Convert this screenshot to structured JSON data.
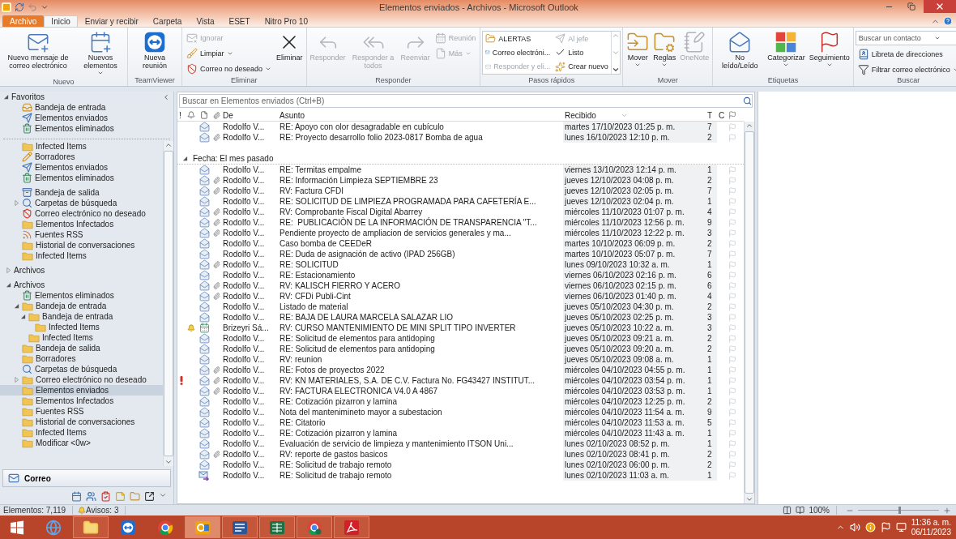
{
  "window": {
    "title": "Elementos enviados - Archivos - Microsoft Outlook"
  },
  "tabs": [
    {
      "label": "Archivo",
      "kind": "backstage",
      "selected": false
    },
    {
      "label": "Inicio",
      "kind": "tab",
      "selected": true
    },
    {
      "label": "Enviar y recibir",
      "kind": "tab",
      "selected": false
    },
    {
      "label": "Carpeta",
      "kind": "tab",
      "selected": false
    },
    {
      "label": "Vista",
      "kind": "tab",
      "selected": false
    },
    {
      "label": "ESET",
      "kind": "tab",
      "selected": false
    },
    {
      "label": "Nitro Pro 10",
      "kind": "tab",
      "selected": false
    }
  ],
  "ribbon": {
    "groups": [
      {
        "label": "Nuevo",
        "items": [
          {
            "kind": "large",
            "label": "Nuevo mensaje de correo electrónico",
            "disabled": false,
            "dropdown": false
          },
          {
            "kind": "large",
            "label": "Nuevos elementos",
            "disabled": false,
            "dropdown": true
          }
        ]
      },
      {
        "label": "TeamViewer",
        "items": [
          {
            "kind": "large",
            "label": "Nueva reunión",
            "disabled": false,
            "dropdown": false
          }
        ]
      },
      {
        "label": "Eliminar",
        "items": [
          {
            "kind": "small",
            "label": "Ignorar",
            "disabled": true,
            "dropdown": false
          },
          {
            "kind": "small",
            "label": "Limpiar",
            "disabled": false,
            "dropdown": true
          },
          {
            "kind": "small",
            "label": "Correo no deseado",
            "disabled": false,
            "dropdown": true
          },
          {
            "kind": "large",
            "label": "Eliminar",
            "disabled": false,
            "dropdown": false
          }
        ]
      },
      {
        "label": "Responder",
        "items": [
          {
            "kind": "large",
            "label": "Responder",
            "disabled": true,
            "dropdown": false
          },
          {
            "kind": "large",
            "label": "Responder a todos",
            "disabled": true,
            "dropdown": false
          },
          {
            "kind": "large",
            "label": "Reenviar",
            "disabled": true,
            "dropdown": false
          },
          {
            "kind": "small",
            "label": "Reunión",
            "disabled": true,
            "dropdown": false
          },
          {
            "kind": "small",
            "label": "Más",
            "disabled": true,
            "dropdown": true
          }
        ]
      },
      {
        "label": "Pasos rápidos",
        "items": [
          {
            "kind": "quickstep",
            "label": "ALERTAS",
            "disabled": false,
            "dropdown": false
          },
          {
            "kind": "quickstep",
            "label": "Al jefe",
            "disabled": true,
            "dropdown": false
          },
          {
            "kind": "quickstep",
            "label": "Correo electróni...",
            "disabled": false,
            "dropdown": false
          },
          {
            "kind": "quickstep",
            "label": "Listo",
            "disabled": false,
            "dropdown": false
          },
          {
            "kind": "quickstep",
            "label": "Responder y eli...",
            "disabled": true,
            "dropdown": false
          },
          {
            "kind": "quickstep",
            "label": "Crear nuevo",
            "disabled": false,
            "dropdown": false
          }
        ]
      },
      {
        "label": "Mover",
        "items": [
          {
            "kind": "large",
            "label": "Mover",
            "disabled": false,
            "dropdown": true
          },
          {
            "kind": "large",
            "label": "Reglas",
            "disabled": false,
            "dropdown": true
          },
          {
            "kind": "large",
            "label": "OneNote",
            "disabled": true,
            "dropdown": false
          }
        ]
      },
      {
        "label": "Etiquetas",
        "items": [
          {
            "kind": "large",
            "label": "No leído/Leído",
            "disabled": false,
            "dropdown": false
          },
          {
            "kind": "large",
            "label": "Categorizar",
            "disabled": false,
            "dropdown": true
          },
          {
            "kind": "large",
            "label": "Seguimiento",
            "disabled": false,
            "dropdown": true
          }
        ]
      },
      {
        "label": "Buscar",
        "items": [
          {
            "kind": "field",
            "placeholder": "Buscar un contacto",
            "disabled": false,
            "dropdown": true
          },
          {
            "kind": "small",
            "label": "Libreta de direcciones",
            "disabled": false,
            "dropdown": false
          },
          {
            "kind": "small",
            "label": "Filtrar correo electrónico",
            "disabled": false,
            "dropdown": true
          }
        ]
      }
    ]
  },
  "favorites": {
    "label": "Favoritos",
    "expanded": true,
    "items": [
      {
        "label": "Bandeja de entrada",
        "kind": "inbox",
        "selected": false
      },
      {
        "label": "Elementos enviados",
        "kind": "sent",
        "selected": false
      },
      {
        "label": "Elementos eliminados",
        "kind": "deleted",
        "selected": false
      }
    ]
  },
  "tree": [
    {
      "label": "Infected Items",
      "kind": "folder",
      "selected": false
    },
    {
      "label": "Borradores",
      "kind": "drafts",
      "selected": false
    },
    {
      "label": "Elementos enviados",
      "kind": "sent",
      "selected": false
    },
    {
      "label": "Elementos eliminados",
      "kind": "deleted",
      "selected": false
    },
    {
      "label": "Bandeja de salida",
      "kind": "outbox",
      "selected": false
    },
    {
      "label": "Carpetas de búsqueda",
      "kind": "search",
      "selected": false,
      "expanded": false
    },
    {
      "label": "Correo electrónico no deseado",
      "kind": "junk",
      "selected": false
    },
    {
      "label": "Elementos Infectados",
      "kind": "folder",
      "selected": false
    },
    {
      "label": "Fuentes RSS",
      "kind": "rss",
      "selected": false
    },
    {
      "label": "Historial de conversaciones",
      "kind": "folder",
      "selected": false
    },
    {
      "label": "Infected Items",
      "kind": "folder",
      "selected": false
    },
    {
      "label": "Archivos",
      "kind": "root",
      "selected": false,
      "expanded": false
    },
    {
      "label": "Archivos",
      "kind": "root",
      "selected": false,
      "expanded": true,
      "children": [
        {
          "label": "Elementos eliminados",
          "kind": "deleted",
          "selected": false
        },
        {
          "label": "Bandeja de entrada",
          "kind": "folder",
          "selected": false,
          "expanded": true,
          "children": [
            {
              "label": "Bandeja de entrada",
              "kind": "folder",
              "selected": false,
              "expanded": true,
              "children": [
                {
                  "label": "Infected Items",
                  "kind": "folder",
                  "selected": false
                }
              ]
            },
            {
              "label": "Infected Items",
              "kind": "folder",
              "selected": false
            }
          ]
        },
        {
          "label": "Bandeja de salida",
          "kind": "folder",
          "selected": false
        },
        {
          "label": "Borradores",
          "kind": "folder",
          "selected": false
        },
        {
          "label": "Carpetas de búsqueda",
          "kind": "search",
          "selected": false
        },
        {
          "label": "Correo electrónico no deseado",
          "kind": "folder",
          "selected": false,
          "expanded": false
        },
        {
          "label": "Elementos enviados",
          "kind": "folder",
          "selected": true
        },
        {
          "label": "Elementos Infectados",
          "kind": "folder",
          "selected": false
        },
        {
          "label": "Fuentes RSS",
          "kind": "folder",
          "selected": false
        },
        {
          "label": "Historial de conversaciones",
          "kind": "folder",
          "selected": false
        },
        {
          "label": "Infected Items",
          "kind": "folder",
          "selected": false
        },
        {
          "label": "Modificar <0w>",
          "kind": "folder",
          "selected": false
        }
      ]
    }
  ],
  "navigation": {
    "buttons": [
      {
        "label": "Correo",
        "selected": true
      }
    ]
  },
  "message_list": {
    "search": {
      "placeholder": "Buscar en Elementos enviados (Ctrl+B)"
    },
    "columns": [
      "!",
      "De",
      "Asunto",
      "Recibido",
      "T",
      "C"
    ],
    "items": [
      {
        "kind": "mail",
        "important": false,
        "reminder": false,
        "attachment": false,
        "from": "Rodolfo V...",
        "subject": "RE: Apoyo con olor desagradable en cubículo",
        "received": "martes 17/10/2023 01:25 p. m.",
        "t": "7"
      },
      {
        "kind": "mail",
        "important": false,
        "reminder": false,
        "attachment": true,
        "from": "Rodolfo V...",
        "subject": "RE: Proyecto desarrollo folio 2023-0817 Bomba de agua",
        "received": "lunes 16/10/2023 12:10 p. m.",
        "t": "2"
      },
      {
        "kind": "group",
        "label": "Fecha: El mes pasado",
        "expanded": true
      },
      {
        "kind": "mail",
        "important": false,
        "reminder": false,
        "attachment": false,
        "from": "Rodolfo V...",
        "subject": "RE: Termitas empalme",
        "received": "viernes 13/10/2023 12:14 p. m.",
        "t": "1"
      },
      {
        "kind": "mail",
        "important": false,
        "reminder": false,
        "attachment": true,
        "from": "Rodolfo V...",
        "subject": "RE: Información Limpieza SEPTIEMBRE 23",
        "received": "jueves 12/10/2023 04:08 p. m.",
        "t": "2"
      },
      {
        "kind": "mail",
        "important": false,
        "reminder": false,
        "attachment": true,
        "from": "Rodolfo V...",
        "subject": "RV: Factura CFDI",
        "received": "jueves 12/10/2023 02:05 p. m.",
        "t": "7"
      },
      {
        "kind": "mail",
        "important": false,
        "reminder": false,
        "attachment": false,
        "from": "Rodolfo V...",
        "subject": "RE: SOLICITUD DE LIMPIEZA PROGRAMADA PARA CAFETERÍA E...",
        "received": "jueves 12/10/2023 02:04 p. m.",
        "t": "1"
      },
      {
        "kind": "mail",
        "important": false,
        "reminder": false,
        "attachment": true,
        "from": "Rodolfo V...",
        "subject": "RV: Comprobante Fiscal Digital Abarrey",
        "received": "miércoles 11/10/2023 01:07 p. m.",
        "t": "4"
      },
      {
        "kind": "mail",
        "important": false,
        "reminder": false,
        "attachment": true,
        "from": "Rodolfo V...",
        "subject": "RE:  PUBLICACIÒN DE LA INFORMACIÓN DE TRANSPARENCIA \"T...",
        "received": "miércoles 11/10/2023 12:56 p. m.",
        "t": "9"
      },
      {
        "kind": "mail",
        "important": false,
        "reminder": false,
        "attachment": true,
        "from": "Rodolfo V...",
        "subject": "Pendiente proyecto de ampliacion de servicios generales y ma...",
        "received": "miércoles 11/10/2023 12:22 p. m.",
        "t": "3"
      },
      {
        "kind": "mail",
        "important": false,
        "reminder": false,
        "attachment": false,
        "from": "Rodolfo V...",
        "subject": "Caso bomba de CEEDeR",
        "received": "martes 10/10/2023 06:09 p. m.",
        "t": "2"
      },
      {
        "kind": "mail",
        "important": false,
        "reminder": false,
        "attachment": false,
        "from": "Rodolfo V...",
        "subject": "RE: Duda de asignación de activo (IPAD 256GB)",
        "received": "martes 10/10/2023 05:07 p. m.",
        "t": "7"
      },
      {
        "kind": "mail",
        "important": false,
        "reminder": false,
        "attachment": true,
        "from": "Rodolfo V...",
        "subject": "RE: SOLICITUD",
        "received": "lunes 09/10/2023 10:32 a. m.",
        "t": "1"
      },
      {
        "kind": "mail",
        "important": false,
        "reminder": false,
        "attachment": false,
        "from": "Rodolfo V...",
        "subject": "RE: Estacionamiento",
        "received": "viernes 06/10/2023 02:16 p. m.",
        "t": "6"
      },
      {
        "kind": "mail",
        "important": false,
        "reminder": false,
        "attachment": true,
        "from": "Rodolfo V...",
        "subject": "RV: KALISCH FIERRO Y ACERO",
        "received": "viernes 06/10/2023 02:15 p. m.",
        "t": "6"
      },
      {
        "kind": "mail",
        "important": false,
        "reminder": false,
        "attachment": true,
        "from": "Rodolfo V...",
        "subject": "RV: CFDi Publi-Cint",
        "received": "viernes 06/10/2023 01:40 p. m.",
        "t": "4"
      },
      {
        "kind": "mail",
        "important": false,
        "reminder": false,
        "attachment": false,
        "from": "Rodolfo V...",
        "subject": "Listado de material",
        "received": "jueves 05/10/2023 04:30 p. m.",
        "t": "2"
      },
      {
        "kind": "mail",
        "important": false,
        "reminder": false,
        "attachment": false,
        "from": "Rodolfo V...",
        "subject": "RE: BAJA DE LAURA MARCELA SALAZAR LIO",
        "received": "jueves 05/10/2023 02:25 p. m.",
        "t": "3"
      },
      {
        "kind": "meeting",
        "important": false,
        "reminder": true,
        "attachment": false,
        "from": "Brizeyri Sá...",
        "subject": "RV: CURSO MANTENIMIENTO DE MINI SPLIT TIPO INVERTER",
        "received": "jueves 05/10/2023 10:22 a. m.",
        "t": "3"
      },
      {
        "kind": "mail",
        "important": false,
        "reminder": false,
        "attachment": false,
        "from": "Rodolfo V...",
        "subject": "RE: Solicitud de elementos para antidoping",
        "received": "jueves 05/10/2023 09:21 a. m.",
        "t": "2"
      },
      {
        "kind": "mail",
        "important": false,
        "reminder": false,
        "attachment": false,
        "from": "Rodolfo V...",
        "subject": "RE: Solicitud de elementos para antidoping",
        "received": "jueves 05/10/2023 09:20 a. m.",
        "t": "2"
      },
      {
        "kind": "mail",
        "important": false,
        "reminder": false,
        "attachment": false,
        "from": "Rodolfo V...",
        "subject": "RV: reunion",
        "received": "jueves 05/10/2023 09:08 a. m.",
        "t": "1"
      },
      {
        "kind": "mail",
        "important": false,
        "reminder": false,
        "attachment": true,
        "from": "Rodolfo V...",
        "subject": "RE: Fotos de proyectos 2022",
        "received": "miércoles 04/10/2023 04:55 p. m.",
        "t": "1"
      },
      {
        "kind": "mail",
        "important": true,
        "reminder": false,
        "attachment": true,
        "from": "Rodolfo V...",
        "subject": "RV: KN MATERIALES, S.A. DE C.V. Factura No. FG43427 INSTITUT...",
        "received": "miércoles 04/10/2023 03:54 p. m.",
        "t": "1"
      },
      {
        "kind": "mail",
        "important": false,
        "reminder": false,
        "attachment": true,
        "from": "Rodolfo V...",
        "subject": "RV: FACTURA ELECTRONICA V4.0 A 4867",
        "received": "miércoles 04/10/2023 03:53 p. m.",
        "t": "1"
      },
      {
        "kind": "mail",
        "important": false,
        "reminder": false,
        "attachment": false,
        "from": "Rodolfo V...",
        "subject": "RE: Cotización pizarron y lamina",
        "received": "miércoles 04/10/2023 12:25 p. m.",
        "t": "2"
      },
      {
        "kind": "mail",
        "important": false,
        "reminder": false,
        "attachment": false,
        "from": "Rodolfo V...",
        "subject": "Nota del mantenimineto mayor a subestacion",
        "received": "miércoles 04/10/2023 11:54 a. m.",
        "t": "9"
      },
      {
        "kind": "mail",
        "important": false,
        "reminder": false,
        "attachment": false,
        "from": "Rodolfo V...",
        "subject": "RE: Citatorio",
        "received": "miércoles 04/10/2023 11:53 a. m.",
        "t": "5"
      },
      {
        "kind": "mail",
        "important": false,
        "reminder": false,
        "attachment": false,
        "from": "Rodolfo V...",
        "subject": "RE: Cotización pizarron y lamina",
        "received": "miércoles 04/10/2023 11:43 a. m.",
        "t": "1"
      },
      {
        "kind": "mail",
        "important": false,
        "reminder": false,
        "attachment": false,
        "from": "Rodolfo V...",
        "subject": "Evaluación de servicio de limpieza y mantenimiento ITSON Uni...",
        "received": "lunes 02/10/2023 08:52 p. m.",
        "t": "1"
      },
      {
        "kind": "mail",
        "important": false,
        "reminder": false,
        "attachment": true,
        "from": "Rodolfo V...",
        "subject": "RV: reporte de gastos basicos",
        "received": "lunes 02/10/2023 08:41 p. m.",
        "t": "2"
      },
      {
        "kind": "mail",
        "important": false,
        "reminder": false,
        "attachment": false,
        "from": "Rodolfo V...",
        "subject": "RE: Solicitud de trabajo remoto",
        "received": "lunes 02/10/2023 06:00 p. m.",
        "t": "2"
      },
      {
        "kind": "forwarded",
        "important": false,
        "reminder": false,
        "attachment": false,
        "from": "Rodolfo V...",
        "subject": "RE: Solicitud de trabajo remoto",
        "received": "lunes 02/10/2023 11:03 a. m.",
        "t": "1"
      }
    ]
  },
  "status_bar": {
    "items": "Elementos: 7,119",
    "reminders": "Avisos: 3",
    "zoom": {
      "label": "100%",
      "level": 0.5
    }
  },
  "taskbar": {
    "apps": [
      {
        "selected": false,
        "running": false
      },
      {
        "selected": false,
        "running": true
      },
      {
        "selected": false,
        "running": false
      },
      {
        "selected": false,
        "running": false
      },
      {
        "selected": true,
        "running": true
      },
      {
        "selected": false,
        "running": true
      },
      {
        "selected": false,
        "running": true
      },
      {
        "selected": false,
        "running": true
      },
      {
        "selected": false,
        "running": true
      }
    ],
    "clock": {
      "time": "11:36 a. m.",
      "date": "06/11/2023"
    }
  }
}
